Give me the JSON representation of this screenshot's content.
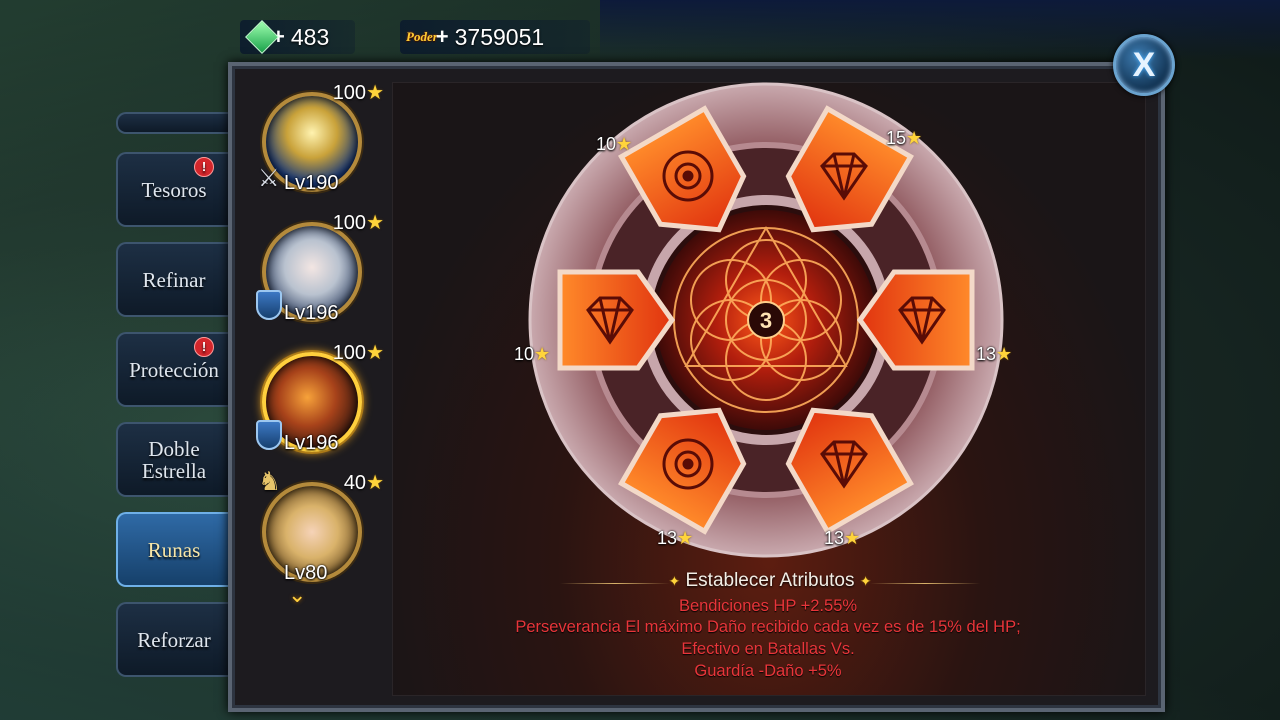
{
  "currency": {
    "gems": "483",
    "power_label": "Poder",
    "power": "3759051"
  },
  "close_label": "X",
  "tabs": [
    {
      "label": "",
      "badge": false,
      "active": false
    },
    {
      "label": "Tesoros",
      "badge": true,
      "active": false
    },
    {
      "label": "Refinar",
      "badge": false,
      "active": false
    },
    {
      "label": "Protección",
      "badge": true,
      "active": false
    },
    {
      "label": "Doble Estrella",
      "badge": false,
      "active": false
    },
    {
      "label": "Runas",
      "badge": false,
      "active": true
    },
    {
      "label": "Reforzar",
      "badge": false,
      "active": false
    }
  ],
  "badge_symbol": "!",
  "heroes": [
    {
      "stars": "100",
      "level": "Lv190",
      "icon": "crossed-swords-icon"
    },
    {
      "stars": "100",
      "level": "Lv196",
      "icon": "shield-icon"
    },
    {
      "stars": "100",
      "level": "Lv196",
      "icon": "shield-icon",
      "selected": true
    },
    {
      "stars": "40",
      "level": "Lv80",
      "icon": "horse-icon"
    }
  ],
  "runes": {
    "center_level": "3",
    "slots": [
      {
        "stars": "10",
        "symbol": "eye"
      },
      {
        "stars": "15",
        "symbol": "gem"
      },
      {
        "stars": "13",
        "symbol": "gem"
      },
      {
        "stars": "13",
        "symbol": "gem"
      },
      {
        "stars": "13",
        "symbol": "eye"
      },
      {
        "stars": "10",
        "symbol": "gem"
      }
    ]
  },
  "attributes": {
    "title": "Establecer Atributos",
    "lines": [
      "Bendiciones  HP +2.55%",
      "Perseverancia  El máximo Daño recibido cada vez es de 15% del HP;",
      "Efectivo en Batallas Vs.",
      "Guardía  -Daño +5%"
    ]
  },
  "colors": {
    "accent_gold": "#ffd43b",
    "attr_red": "#e8353a",
    "rune_orange": "#ff6a1a"
  }
}
